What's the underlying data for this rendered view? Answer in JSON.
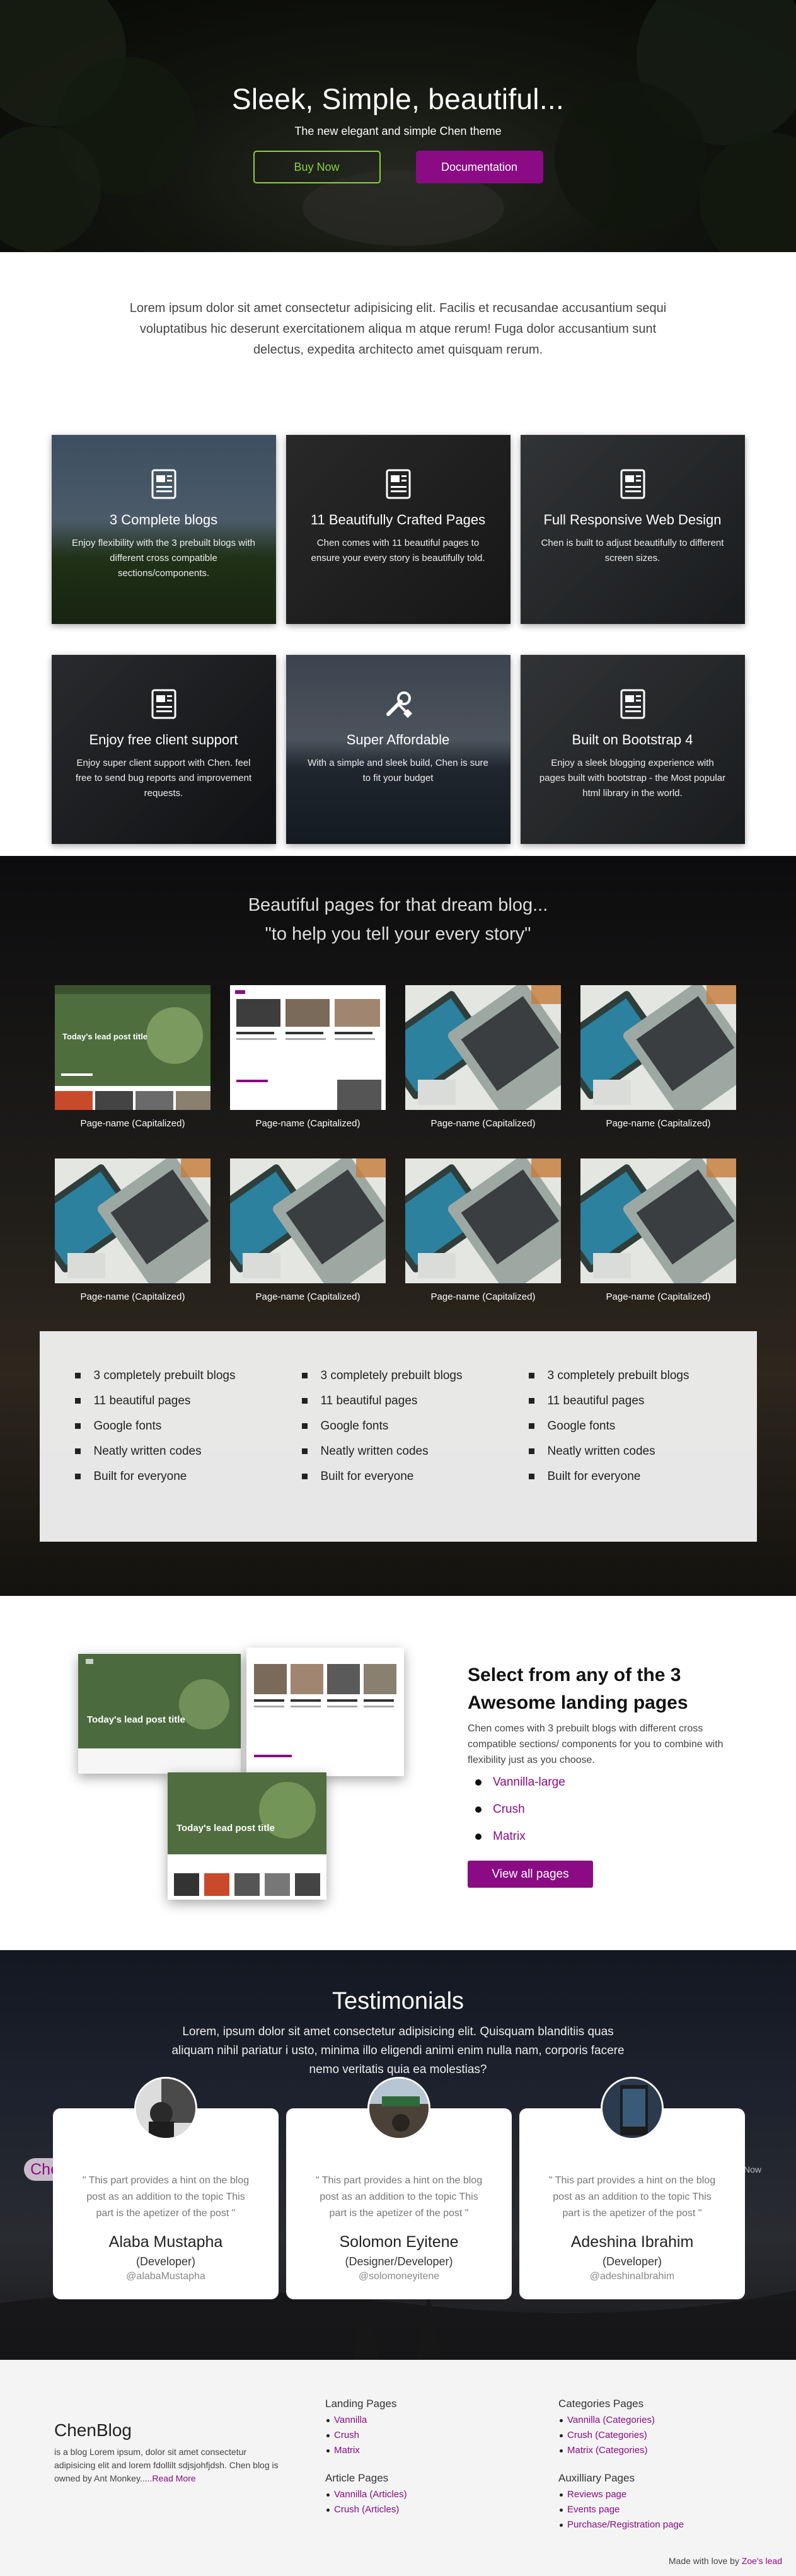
{
  "colors": {
    "accent": "#8a0b84",
    "green": "#8bd23b",
    "dark": "#111111"
  },
  "hero": {
    "title": "Sleek, Simple, beautiful...",
    "subtitle": "The new elegant and simple Chen theme",
    "buy_label": "Buy Now",
    "docs_label": "Documentation"
  },
  "intro": {
    "text": "Lorem ipsum dolor sit amet consectetur adipisicing elit. Facilis et recusandae accusantium sequi voluptatibus hic deserunt exercitationem aliqua m atque rerum! Fuga dolor accusantium sunt delectus, expedita architecto amet quisquam rerum."
  },
  "features": [
    {
      "icon": "document-icon",
      "title": "3 Complete blogs",
      "text": "Enjoy flexibility with the 3 prebuilt blogs with different cross compatible sections/components."
    },
    {
      "icon": "document-icon",
      "title": "11 Beautifully Crafted Pages",
      "text": "Chen comes with 11 beautiful pages to ensure your every story is beautifully told."
    },
    {
      "icon": "document-icon",
      "title": "Full Responsive Web Design",
      "text": "Chen is built to adjust beautifully to different screen sizes."
    },
    {
      "icon": "document-icon",
      "title": "Enjoy free client support",
      "text": "Enjoy super client support with Chen. feel free to send bug reports and improvement requests."
    },
    {
      "icon": "tools-icon",
      "title": "Super Affordable",
      "text": "With a simple and sleek build, Chen is sure to fit your budget"
    },
    {
      "icon": "document-icon",
      "title": "Built on Bootstrap 4",
      "text": "Enjoy a sleek blogging experience with pages built with bootstrap - the Most popular html library in the world."
    }
  ],
  "pages": {
    "line1": "Beautiful pages for that dream blog...",
    "line2": "\"to help you tell your every story\"",
    "thumb_hero_title": "Today's lead post title",
    "thumbs": [
      {
        "caption": "Page-name (Capitalized)",
        "kind": "lead"
      },
      {
        "caption": "Page-name (Capitalized)",
        "kind": "grid"
      },
      {
        "caption": "Page-name (Capitalized)",
        "kind": "laptop"
      },
      {
        "caption": "Page-name (Capitalized)",
        "kind": "laptop"
      },
      {
        "caption": "Page-name (Capitalized)",
        "kind": "laptop"
      },
      {
        "caption": "Page-name (Capitalized)",
        "kind": "laptop"
      },
      {
        "caption": "Page-name (Capitalized)",
        "kind": "laptop"
      },
      {
        "caption": "Page-name (Capitalized)",
        "kind": "laptop"
      }
    ],
    "lists": [
      [
        "3 completely prebuilt blogs",
        "11 beautiful pages",
        "Google fonts",
        "Neatly written codes",
        "Built for everyone"
      ],
      [
        "3 completely prebuilt blogs",
        "11 beautiful pages",
        "Google fonts",
        "Neatly written codes",
        "Built for everyone"
      ],
      [
        "3 completely prebuilt blogs",
        "11 beautiful pages",
        "Google fonts",
        "Neatly written codes",
        "Built for everyone"
      ]
    ]
  },
  "select": {
    "title": "Select from any of the 3 Awesome landing pages",
    "desc": "Chen comes with 3 prebuilt blogs with different cross compatible sections/ components for you to combine with flexibility just as you choose.",
    "options": [
      "Vannilla-large",
      "Crush",
      "Matrix"
    ],
    "button": "View all pages",
    "mock_title": "Today's lead post title"
  },
  "testimonials": {
    "title": "Testimonials",
    "subtitle": "Lorem, ipsum dolor sit amet consectetur adipisicing elit. Quisquam blanditiis quas aliquam nihil pariatur i usto, minima illo eligendi animi enim nulla nam, corporis facere nemo veritatis quia ea molestias?",
    "pill": "Chen",
    "now": "Now",
    "items": [
      {
        "quote": "\" This part provides a hint on the blog post as an addition to the topic This part is the apetizer of the post \"",
        "name": "Alaba Mustapha",
        "role": "(Developer)",
        "handle": "@alabaMustapha"
      },
      {
        "quote": "\" This part provides a hint on the blog post as an addition to the topic This part is the apetizer of the post \"",
        "name": "Solomon Eyitene",
        "role": "(Designer/Developer)",
        "handle": "@solomoneyitene"
      },
      {
        "quote": "\" This part provides a hint on the blog post as an addition to the topic This part is the apetizer of the post \"",
        "name": "Adeshina Ibrahim",
        "role": "(Developer)",
        "handle": "@adeshinaIbrahim"
      }
    ]
  },
  "footer": {
    "brand": "ChenBlog",
    "text": "is a blog Lorem ipsum, dolor sit amet consectetur adipisicing elit and lorem fdollilt sdjsjohfjdsh. Chen blog is owned by Ant Monkey.....",
    "read_more": "Read More",
    "landing": {
      "title": "Landing Pages",
      "items": [
        "Vannilla",
        "Crush",
        "Matrix"
      ]
    },
    "article": {
      "title": "Article Pages",
      "items": [
        "Vannilla (Articles)",
        "Crush (Articles)"
      ]
    },
    "categories": {
      "title": "Categories Pages",
      "items": [
        "Vannilla (Categories)",
        "Crush (Categories)",
        "Matrix (Categories)"
      ]
    },
    "auxiliary": {
      "title": "Auxilliary Pages",
      "items": [
        "Reviews page",
        "Events page",
        "Purchase/Registration page"
      ]
    },
    "credit": "Made with love by",
    "credit_link": "Zoe's lead"
  }
}
